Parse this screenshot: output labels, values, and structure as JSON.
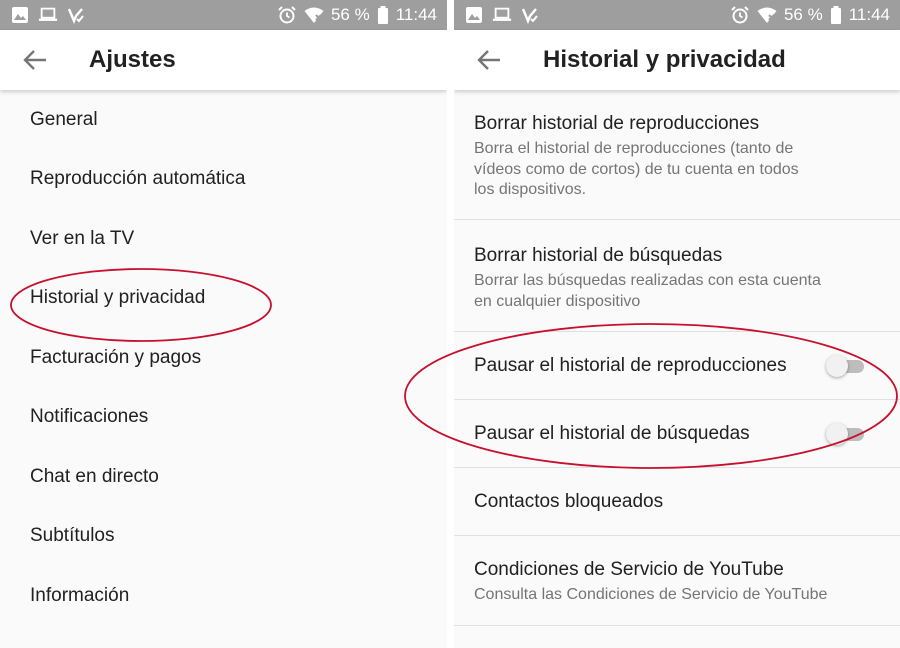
{
  "status_bar": {
    "battery": "56 %",
    "time": "11:44"
  },
  "left_screen": {
    "title": "Ajustes",
    "items": [
      "General",
      "Reproducción automática",
      "Ver en la TV",
      "Historial y privacidad",
      "Facturación y pagos",
      "Notificaciones",
      "Chat en directo",
      "Subtítulos",
      "Información"
    ]
  },
  "right_screen": {
    "title": "Historial y privacidad",
    "items": [
      {
        "title": "Borrar historial de reproducciones",
        "subtitle_lines": [
          "Borra el historial de reproducciones (tanto de",
          "vídeos como de cortos) de tu cuenta en todos",
          "los dispositivos."
        ]
      },
      {
        "title": "Borrar historial de búsquedas",
        "subtitle_lines": [
          "Borrar las búsquedas realizadas con esta cuenta",
          "en cualquier dispositivo"
        ]
      },
      {
        "title": "Pausar el historial de reproducciones",
        "toggle_on": false
      },
      {
        "title": "Pausar el historial de búsquedas",
        "toggle_on": false
      },
      {
        "title": "Contactos bloqueados"
      },
      {
        "title": "Condiciones de Servicio de YouTube",
        "subtitle_lines": [
          "Consulta las Condiciones de Servicio de YouTube"
        ]
      }
    ]
  },
  "colors": {
    "status_bar": "#9e9e9e",
    "annotation": "#c8102e",
    "toggle_off_track": "#bdbdbd"
  },
  "icons": [
    "image-icon",
    "laptop-icon",
    "vpn-check-icon",
    "alarm-icon",
    "wifi-icon",
    "battery-icon",
    "back-arrow-icon"
  ]
}
